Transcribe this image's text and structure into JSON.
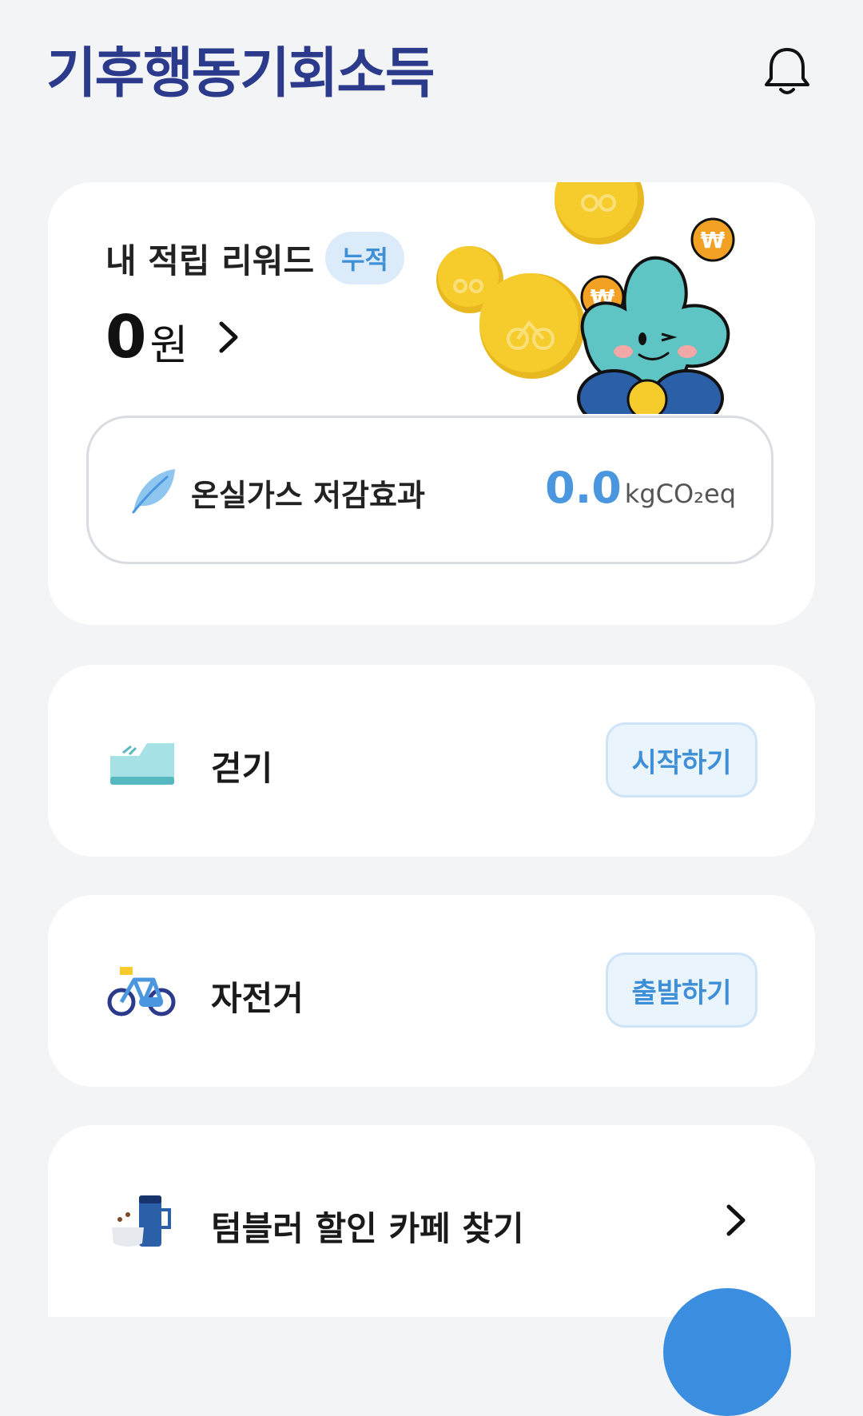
{
  "header": {
    "logo_text": "기후행동기회소득",
    "bell_icon": "bell-icon"
  },
  "reward": {
    "title": "내 적립 리워드",
    "badge": "누적",
    "amount": "0",
    "unit": "원",
    "chevron_icon": "chevron-right-icon",
    "illustration": "mascot-with-coins"
  },
  "ghg": {
    "icon": "leaf-icon",
    "label": "온실가스 저감효과",
    "value": "0.0",
    "unit": "kgCO₂eq",
    "value_color": "#4a97e0"
  },
  "actions": [
    {
      "icon": "sneaker-icon",
      "label": "걷기",
      "button": "시작하기"
    },
    {
      "icon": "bicycle-icon",
      "label": "자전거",
      "button": "출발하기"
    },
    {
      "icon": "tumbler-icon",
      "label": "텀블러 할인 카페 찾기",
      "chevron_icon": "chevron-right-icon"
    }
  ],
  "colors": {
    "brand": "#2c3a8c",
    "accent": "#3f8fd6",
    "background": "#f2f4f6"
  }
}
